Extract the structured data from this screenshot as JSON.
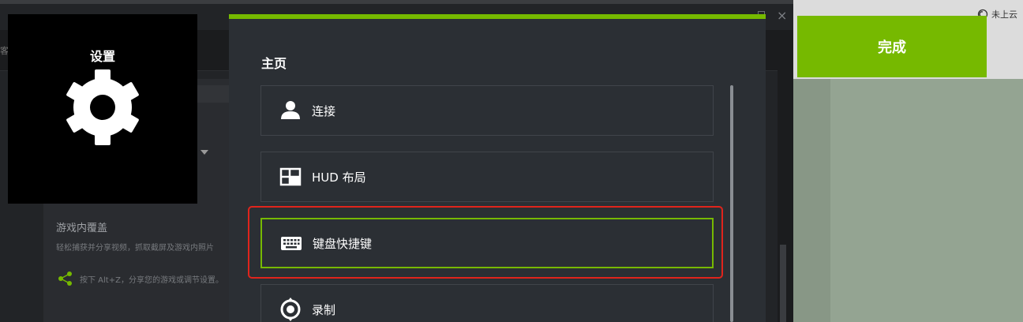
{
  "background_app": {
    "overlay_title": "游戏内覆盖",
    "overlay_desc": "轻松捕获并分享视频，抓取截屏及游戏内照片",
    "overlay_hint": "按下 Alt+Z，分享您的游戏或调节设置。",
    "toolbar_fragment": "客",
    "close_glyph": "×"
  },
  "cloud_status": {
    "label": "未上云"
  },
  "settings_tile": {
    "title": "设置",
    "icon": "gear-icon"
  },
  "done_button": {
    "label": "完成"
  },
  "modal": {
    "title": "主页",
    "items": [
      {
        "label": "连接",
        "icon": "person-icon"
      },
      {
        "label": "HUD 布局",
        "icon": "layout-icon"
      },
      {
        "label": "键盘快捷键",
        "icon": "keyboard-icon",
        "selected": true
      },
      {
        "label": "录制",
        "icon": "record-icon"
      }
    ]
  },
  "colors": {
    "accent": "#76b900",
    "highlight": "#e0241c",
    "modal_bg": "#2b2f34"
  }
}
